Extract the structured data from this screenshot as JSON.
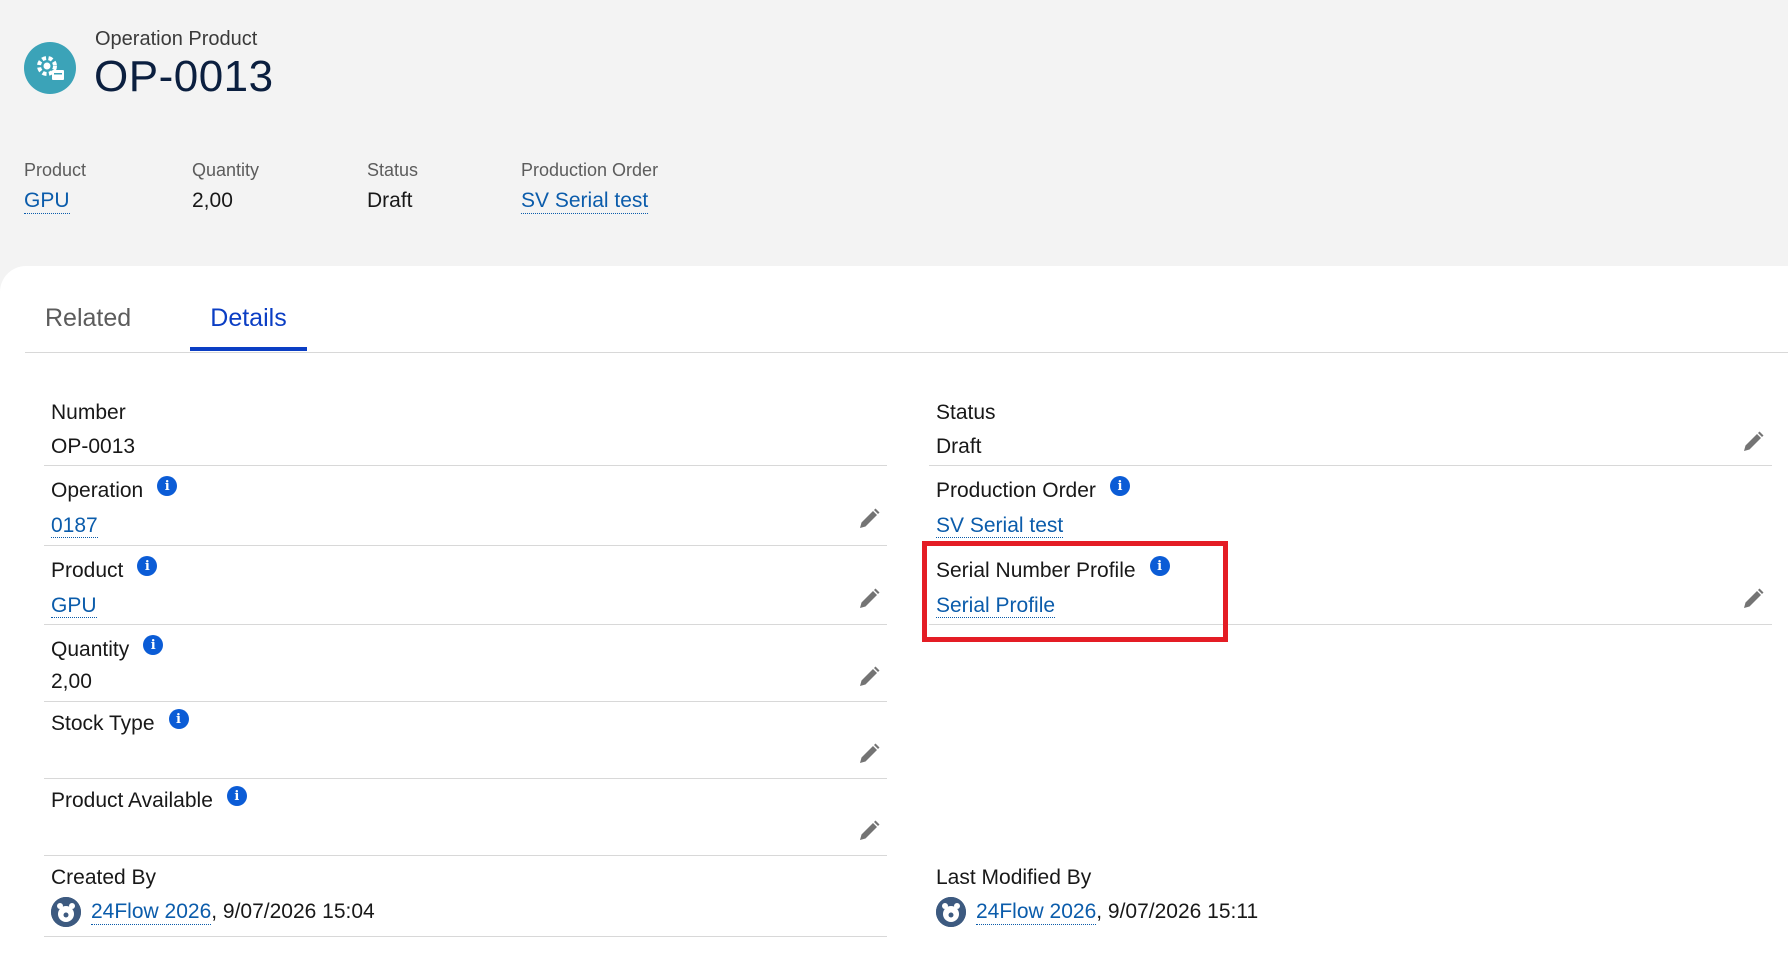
{
  "header": {
    "object_type": "Operation Product",
    "title": "OP-0013",
    "highlights": [
      {
        "label": "Product",
        "value": "GPU"
      },
      {
        "label": "Quantity",
        "value": "2,00"
      },
      {
        "label": "Status",
        "value": "Draft"
      },
      {
        "label": "Production Order",
        "value": "SV Serial test"
      }
    ]
  },
  "tabs": {
    "related": "Related",
    "details": "Details"
  },
  "details": {
    "number": {
      "label": "Number",
      "value": "OP-0013"
    },
    "operation": {
      "label": "Operation",
      "value": "0187"
    },
    "product": {
      "label": "Product",
      "value": "GPU"
    },
    "quantity": {
      "label": "Quantity",
      "value": "2,00"
    },
    "stock_type": {
      "label": "Stock Type",
      "value": ""
    },
    "product_available": {
      "label": "Product Available",
      "value": ""
    },
    "status": {
      "label": "Status",
      "value": "Draft"
    },
    "production_order": {
      "label": "Production Order",
      "value": "SV Serial test"
    },
    "serial_number_profile": {
      "label": "Serial Number Profile",
      "value": "Serial Profile"
    },
    "created_by": {
      "label": "Created By",
      "user": "24Flow 2026",
      "date": ", 9/07/2026 15:04"
    },
    "last_modified_by": {
      "label": "Last Modified By",
      "user": "24Flow 2026",
      "date": ", 9/07/2026 15:11"
    }
  },
  "colors": {
    "brand": "#0b3ec4",
    "link": "#0b5cab",
    "icon_bg": "#3ba3b8",
    "highlight_box": "#e41d25"
  }
}
